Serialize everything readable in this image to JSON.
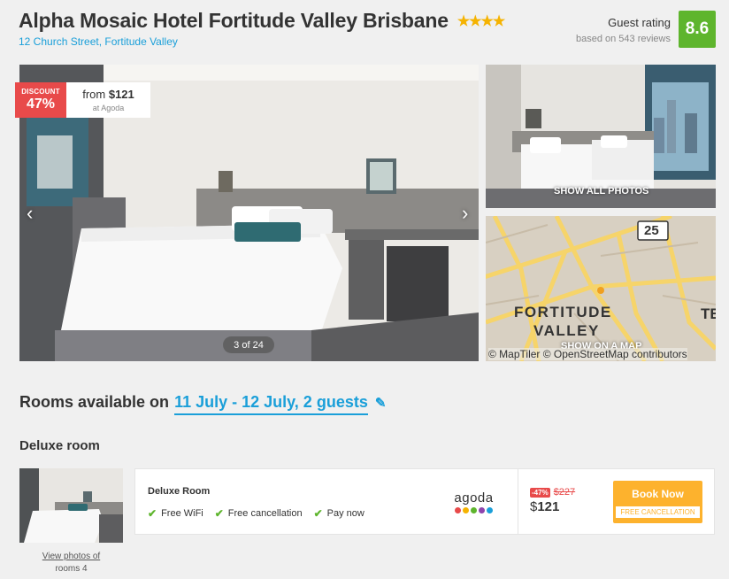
{
  "hotel": {
    "name": "Alpha Mosaic Hotel Fortitude Valley Brisbane",
    "stars": "★★★★",
    "address": "12 Church Street, Fortitude Valley",
    "rating_title": "Guest rating",
    "rating_sub": "based on 543 reviews",
    "rating_score": "8.6"
  },
  "gallery": {
    "discount_label": "DISCOUNT",
    "discount_value": "47%",
    "from_prefix": "from ",
    "from_price": "$121",
    "from_source": "at Agoda",
    "counter": "3 of 24",
    "prev_arrow": "‹",
    "next_arrow": "›",
    "show_all_photos": "SHOW ALL PHOTOS",
    "show_on_map": "SHOW ON A MAP",
    "map_attribution": "© MapTiler © OpenStreetMap contributors",
    "map_labels": [
      "FORTITUDE",
      "VALLEY",
      "25",
      "TE"
    ]
  },
  "rooms": {
    "heading_prefix": "Rooms available on",
    "dates": "11 July - 12 July, 2 guests",
    "edit_icon": "✎",
    "room_name": "Deluxe room",
    "view_photos_line1": "View photos of",
    "view_photos_line2": "rooms 4"
  },
  "offer": {
    "title": "Deluxe Room",
    "features": [
      "Free WiFi",
      "Free cancellation",
      "Pay now"
    ],
    "check_icon": "✔",
    "provider": "agoda",
    "provider_dot_colors": [
      "#e84a4a",
      "#f5b301",
      "#5eb52d",
      "#8e44ad",
      "#1a9fd9"
    ],
    "discount": "-47%",
    "old_price": "$227",
    "currency": "$",
    "new_price": "121",
    "book_label": "Book Now",
    "book_sub": "FREE CANCELLATION"
  },
  "colors": {
    "accent_blue": "#1a9fd9",
    "rating_green": "#5eb52d",
    "discount_red": "#e84a4a",
    "book_orange": "#fdb22d"
  }
}
